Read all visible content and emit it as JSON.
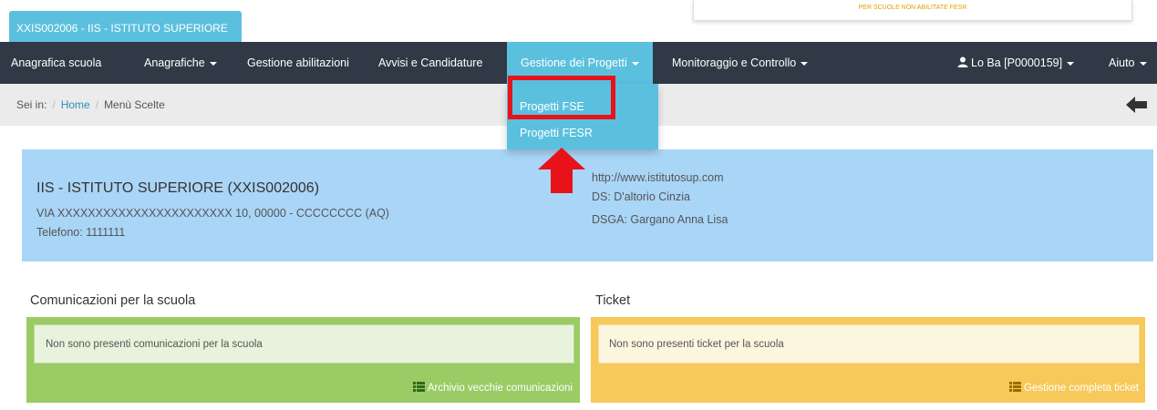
{
  "header": {
    "school_tab": "XXIS002006 - IIS - ISTITUTO SUPERIORE",
    "notice": "PER SCUOLE NON ABILITATE FESR"
  },
  "navbar": {
    "items": [
      {
        "label": "Anagrafica scuola",
        "has_caret": false
      },
      {
        "label": "Anagrafiche",
        "has_caret": true
      },
      {
        "label": "Gestione abilitazioni",
        "has_caret": false
      },
      {
        "label": "Avvisi e Candidature",
        "has_caret": false
      },
      {
        "label": "Gestione dei Progetti",
        "has_caret": true,
        "active": true
      },
      {
        "label": "Monitoraggio e Controllo",
        "has_caret": true
      }
    ],
    "user": "Lo Ba [P0000159]",
    "help": "Aiuto"
  },
  "breadcrumb": {
    "prefix": "Sei in:",
    "home": "Home",
    "current": "Menù Scelte"
  },
  "dropdown": {
    "items": [
      "Progetti FSE",
      "Progetti FESR"
    ],
    "highlighted": "Progetti FSE"
  },
  "school": {
    "name": "IIS - ISTITUTO SUPERIORE (XXIS002006)",
    "address": "VIA XXXXXXXXXXXXXXXXXXXXXXX 10, 00000 - CCCCCCCC (AQ)",
    "phone": "Telefono: 1111111",
    "website": "http://www.istitutosup.com",
    "ds": "DS: D'altorio Cinzia",
    "dsga": "DSGA: Gargano Anna Lisa"
  },
  "communications": {
    "title": "Comunicazioni per la scuola",
    "message": "Non sono presenti comunicazioni per la scuola",
    "footer_link": "Archivio vecchie comunicazioni"
  },
  "ticket": {
    "title": "Ticket",
    "message": "Non sono presenti ticket per la scuola",
    "footer_link": "Gestione completa ticket"
  },
  "colors": {
    "navbar": "#303945",
    "accent": "#5bc0de",
    "info_panel": "#a9d5f7",
    "green_panel": "#9bcb65",
    "yellow_panel": "#f7c95a",
    "highlight": "#e8121b"
  },
  "icons": [
    "user-icon",
    "back-arrow-icon",
    "list-icon",
    "pointer-arrow-icon"
  ]
}
